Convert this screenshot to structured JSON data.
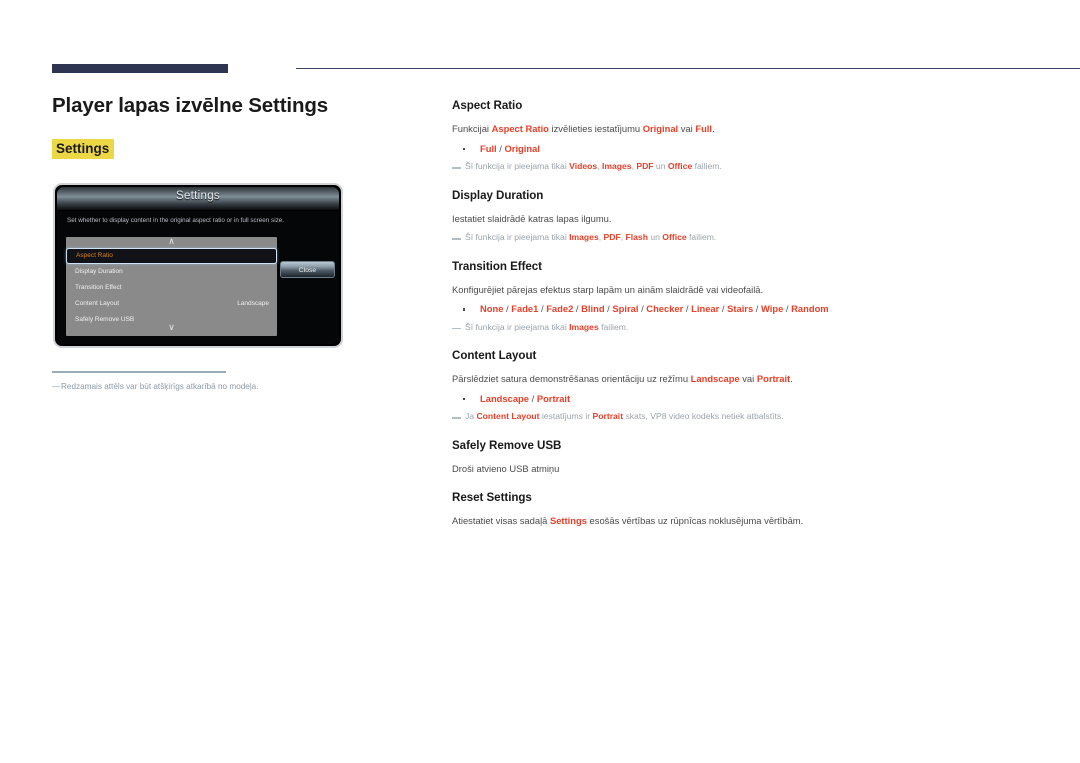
{
  "page": {
    "title": "Player lapas izvēlne Settings",
    "section_tag": "Settings",
    "accent_color": "#e8402a",
    "highlight_color": "#ecd845",
    "rule_color": "#2e3553"
  },
  "figure": {
    "dialog_title": "Settings",
    "description": "Set whether to display content in the original aspect ratio or in full screen size.",
    "scroll_up_icon": "chevron-up-icon",
    "scroll_down_icon": "chevron-down-icon",
    "rows": [
      {
        "label": "Aspect Ratio",
        "value": "",
        "selected": true
      },
      {
        "label": "Display Duration",
        "value": "",
        "selected": false
      },
      {
        "label": "Transition Effect",
        "value": "",
        "selected": false
      },
      {
        "label": "Content Layout",
        "value": "Landscape",
        "selected": false
      },
      {
        "label": "Safely Remove USB",
        "value": "",
        "selected": false
      }
    ],
    "close_label": "Close",
    "footnote": "Redzamais attēls var būt atšķirīgs atkarībā no modeļa."
  },
  "sections": [
    {
      "heading": "Aspect Ratio",
      "body_parts": [
        {
          "text": "Funkcijai ",
          "style": "plain"
        },
        {
          "text": "Aspect Ratio",
          "style": "hl"
        },
        {
          "text": " izvēlieties iestatījumu ",
          "style": "plain"
        },
        {
          "text": "Original",
          "style": "hl"
        },
        {
          "text": " vai ",
          "style": "plain"
        },
        {
          "text": "Full",
          "style": "hl"
        },
        {
          "text": ".",
          "style": "plain"
        }
      ],
      "options": [
        {
          "parts": [
            {
              "text": "Full",
              "style": "hl"
            },
            {
              "text": " / ",
              "style": "sep"
            },
            {
              "text": "Original",
              "style": "hl"
            }
          ]
        }
      ],
      "note_parts": [
        {
          "text": "Šī funkcija ir pieejama tikai ",
          "style": "plain"
        },
        {
          "text": "Videos",
          "style": "hl"
        },
        {
          "text": ", ",
          "style": "plain"
        },
        {
          "text": "Images",
          "style": "hl"
        },
        {
          "text": ", ",
          "style": "plain"
        },
        {
          "text": "PDF",
          "style": "hl"
        },
        {
          "text": " un ",
          "style": "plain"
        },
        {
          "text": "Office",
          "style": "hl"
        },
        {
          "text": " failiem.",
          "style": "plain"
        }
      ]
    },
    {
      "heading": "Display Duration",
      "body_parts": [
        {
          "text": "Iestatiet slaidrādē katras lapas ilgumu.",
          "style": "plain"
        }
      ],
      "options": [],
      "note_parts": [
        {
          "text": "Šī funkcija ir pieejama tikai ",
          "style": "plain"
        },
        {
          "text": "Images",
          "style": "hl"
        },
        {
          "text": ", ",
          "style": "plain"
        },
        {
          "text": "PDF",
          "style": "hl"
        },
        {
          "text": ", ",
          "style": "plain"
        },
        {
          "text": "Flash",
          "style": "hl"
        },
        {
          "text": " un ",
          "style": "plain"
        },
        {
          "text": "Office",
          "style": "hl"
        },
        {
          "text": " failiem.",
          "style": "plain"
        }
      ]
    },
    {
      "heading": "Transition Effect",
      "body_parts": [
        {
          "text": "Konfigurējiet pārejas efektus starp lapām un ainām slaidrādē vai videofailā.",
          "style": "plain"
        }
      ],
      "options": [
        {
          "parts": [
            {
              "text": "None",
              "style": "hl"
            },
            {
              "text": " / ",
              "style": "sep"
            },
            {
              "text": "Fade1",
              "style": "hl"
            },
            {
              "text": " / ",
              "style": "sep"
            },
            {
              "text": "Fade2",
              "style": "hl"
            },
            {
              "text": " / ",
              "style": "sep"
            },
            {
              "text": "Blind",
              "style": "hl"
            },
            {
              "text": " / ",
              "style": "sep"
            },
            {
              "text": "Spiral",
              "style": "hl"
            },
            {
              "text": " / ",
              "style": "sep"
            },
            {
              "text": "Checker",
              "style": "hl"
            },
            {
              "text": " / ",
              "style": "sep"
            },
            {
              "text": "Linear",
              "style": "hl"
            },
            {
              "text": " / ",
              "style": "sep"
            },
            {
              "text": "Stairs",
              "style": "hl"
            },
            {
              "text": " / ",
              "style": "sep"
            },
            {
              "text": "Wipe",
              "style": "hl"
            },
            {
              "text": " / ",
              "style": "sep"
            },
            {
              "text": "Random",
              "style": "hl"
            }
          ]
        }
      ],
      "note_parts": [
        {
          "text": "Šī funkcija ir pieejama tikai ",
          "style": "plain"
        },
        {
          "text": "Images",
          "style": "hl"
        },
        {
          "text": " failiem.",
          "style": "plain"
        }
      ]
    },
    {
      "heading": "Content Layout",
      "body_parts": [
        {
          "text": "Pārslēdziet satura demonstrēšanas orientāciju uz režīmu ",
          "style": "plain"
        },
        {
          "text": "Landscape",
          "style": "hl"
        },
        {
          "text": " vai ",
          "style": "plain"
        },
        {
          "text": "Portrait",
          "style": "hl"
        },
        {
          "text": ".",
          "style": "plain"
        }
      ],
      "options": [
        {
          "parts": [
            {
              "text": "Landscape",
              "style": "hl"
            },
            {
              "text": " / ",
              "style": "sep"
            },
            {
              "text": "Portrait",
              "style": "hl"
            }
          ]
        }
      ],
      "note_parts": [
        {
          "text": "Ja ",
          "style": "plain"
        },
        {
          "text": "Content Layout",
          "style": "hl"
        },
        {
          "text": " iestatījums ir ",
          "style": "plain"
        },
        {
          "text": "Portrait",
          "style": "hl"
        },
        {
          "text": " skats, VP8 video kodeks netiek atbalstīts.",
          "style": "plain"
        }
      ]
    },
    {
      "heading": "Safely Remove USB",
      "body_parts": [
        {
          "text": "Droši atvieno USB atmiņu",
          "style": "plain"
        }
      ],
      "options": [],
      "note_parts": []
    },
    {
      "heading": "Reset Settings",
      "body_parts": [
        {
          "text": "Atiestatiet visas sadaļā ",
          "style": "plain"
        },
        {
          "text": "Settings",
          "style": "hl"
        },
        {
          "text": " esošās vērtības uz rūpnīcas noklusējuma vērtībām.",
          "style": "plain"
        }
      ],
      "options": [],
      "note_parts": []
    }
  ]
}
